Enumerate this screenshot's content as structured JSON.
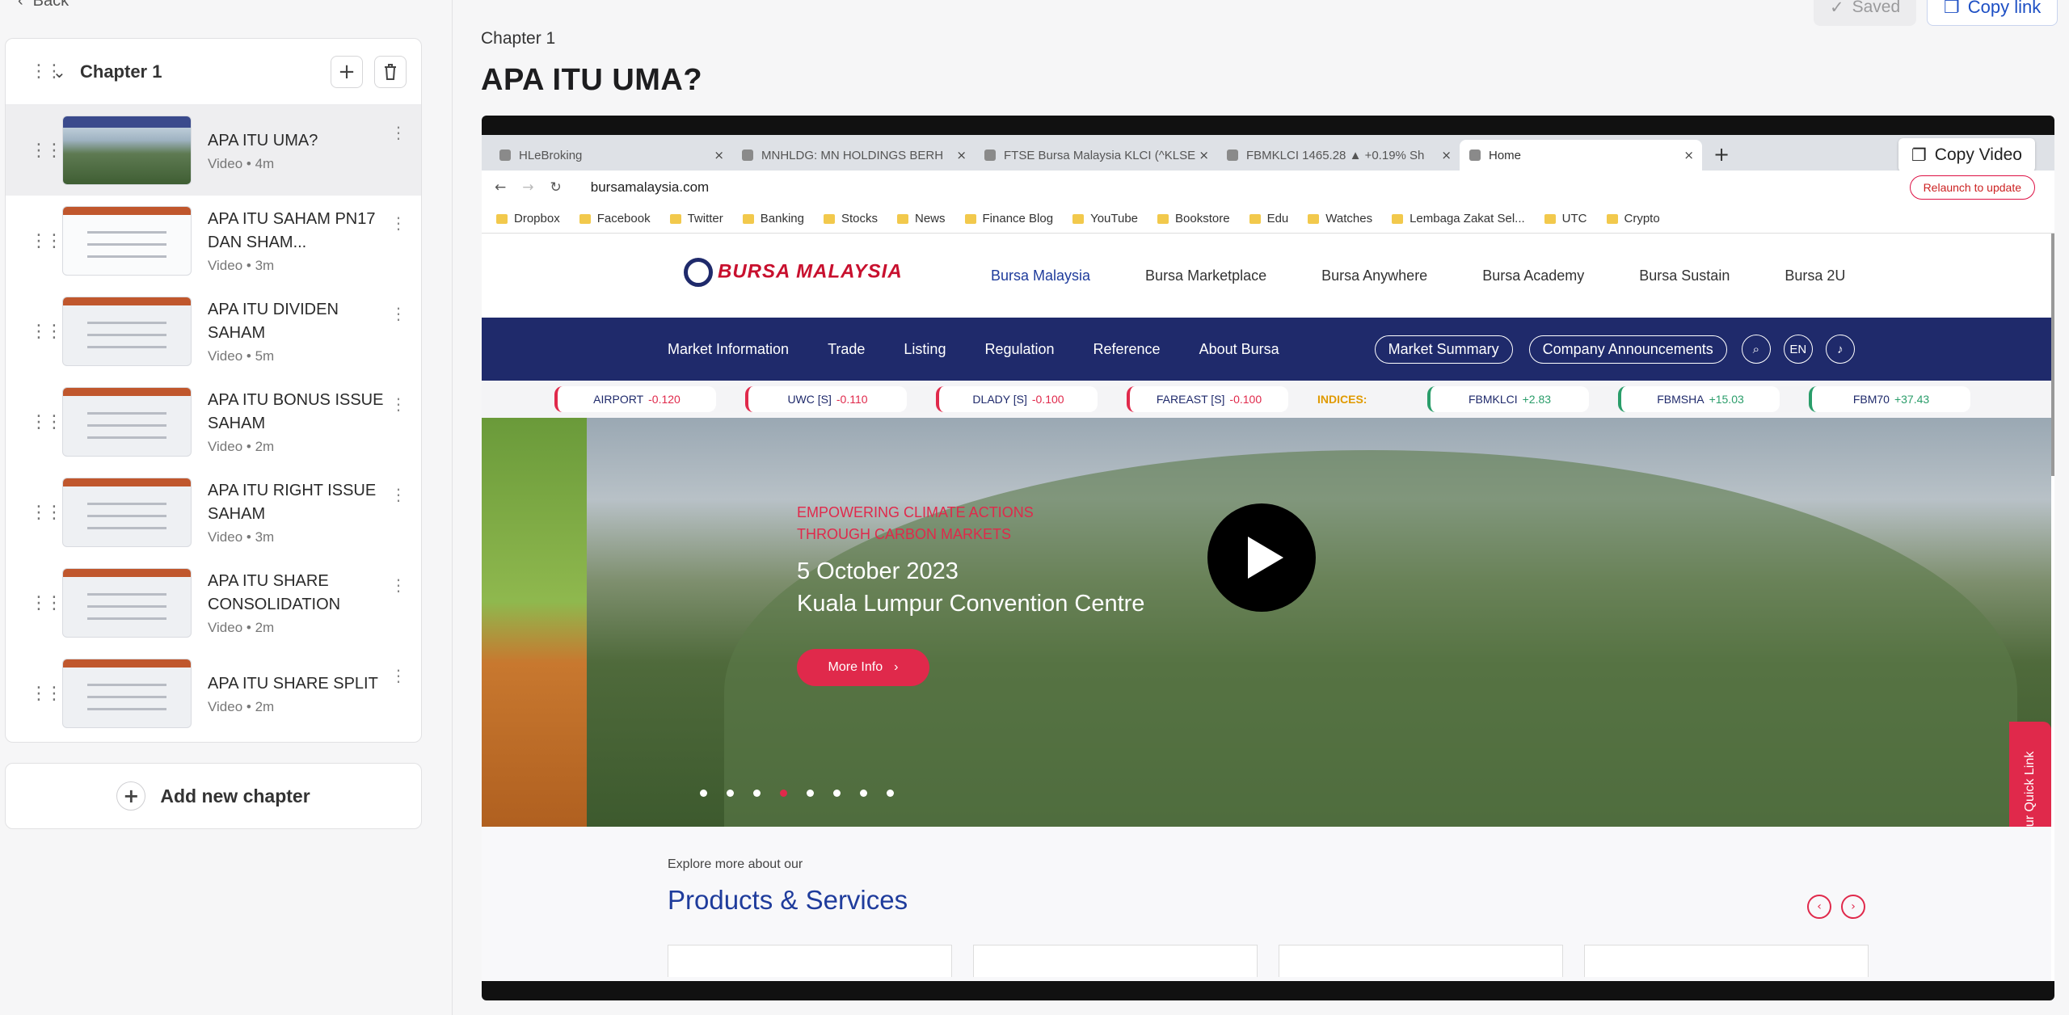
{
  "sidebar": {
    "back_label": "Back",
    "chapter": {
      "title": "Chapter 1"
    },
    "lessons": [
      {
        "title": "APA ITU UMA?",
        "meta": "Video • 4m",
        "thumb": "mtn"
      },
      {
        "title": "APA ITU SAHAM PN17 DAN SHAM...",
        "meta": "Video • 3m",
        "thumb": "chart"
      },
      {
        "title": "APA ITU DIVIDEN SAHAM",
        "meta": "Video • 5m",
        "thumb": "doc"
      },
      {
        "title": "APA ITU BONUS ISSUE SAHAM",
        "meta": "Video • 2m",
        "thumb": "doc"
      },
      {
        "title": "APA ITU RIGHT ISSUE SAHAM",
        "meta": "Video • 3m",
        "thumb": "doc"
      },
      {
        "title": "APA ITU SHARE CONSOLIDATION",
        "meta": "Video • 2m",
        "thumb": "doc"
      },
      {
        "title": "APA ITU SHARE SPLIT",
        "meta": "Video • 2m",
        "thumb": "doc"
      }
    ],
    "add_chapter_label": "Add new chapter"
  },
  "main": {
    "breadcrumb": "Chapter 1",
    "title": "APA ITU UMA?",
    "saved_label": "Saved",
    "copy_link_label": "Copy link",
    "copy_video_label": "Copy Video"
  },
  "video_frame": {
    "tabs": [
      "HLeBroking",
      "MNHLDG: MN HOLDINGS BERH",
      "FTSE Bursa Malaysia KLCI (^KLSE",
      "FBMKLCI 1465.28 ▲ +0.19% Sh",
      "Home"
    ],
    "url": "bursamalaysia.com",
    "relaunch_label": "Relaunch to update",
    "bookmarks": [
      "Dropbox",
      "Facebook",
      "Twitter",
      "Banking",
      "Stocks",
      "News",
      "Finance Blog",
      "YouTube",
      "Bookstore",
      "Edu",
      "Watches",
      "Lembaga Zakat Sel...",
      "UTC",
      "Crypto"
    ],
    "logo_text": "BURSA MALAYSIA",
    "top_nav": [
      "Bursa Malaysia",
      "Bursa Marketplace",
      "Bursa Anywhere",
      "Bursa Academy",
      "Bursa Sustain",
      "Bursa 2U"
    ],
    "main_nav": [
      "Market Information",
      "Trade",
      "Listing",
      "Regulation",
      "Reference",
      "About Bursa"
    ],
    "market_summary": "Market Summary",
    "company_announcements": "Company Announcements",
    "lang": "EN",
    "ticker": [
      {
        "name": "AIRPORT",
        "change": "-0.120"
      },
      {
        "name": "UWC [S]",
        "change": "-0.110"
      },
      {
        "name": "DLADY [S]",
        "change": "-0.100"
      },
      {
        "name": "FAREAST [S]",
        "change": "-0.100"
      }
    ],
    "indices_label": "INDICES:",
    "indices": [
      {
        "name": "FBMKLCI",
        "change": "+2.83"
      },
      {
        "name": "FBMSHA",
        "change": "+15.03"
      },
      {
        "name": "FBM70",
        "change": "+37.43"
      }
    ],
    "hero": {
      "tag_line1": "EMPOWERING CLIMATE ACTIONS",
      "tag_line2": "THROUGH CARBON MARKETS",
      "date": "5 October 2023",
      "venue": "Kuala Lumpur Convention Centre",
      "button": "More Info"
    },
    "quick_link": "Personalize Your Quick Link",
    "explore": "Explore more about our",
    "products_title": "Products & Services"
  },
  "colors": {
    "accent": "#1d4fc4",
    "bursa_navy": "#1f2a6b",
    "bursa_red": "#e0294b"
  }
}
